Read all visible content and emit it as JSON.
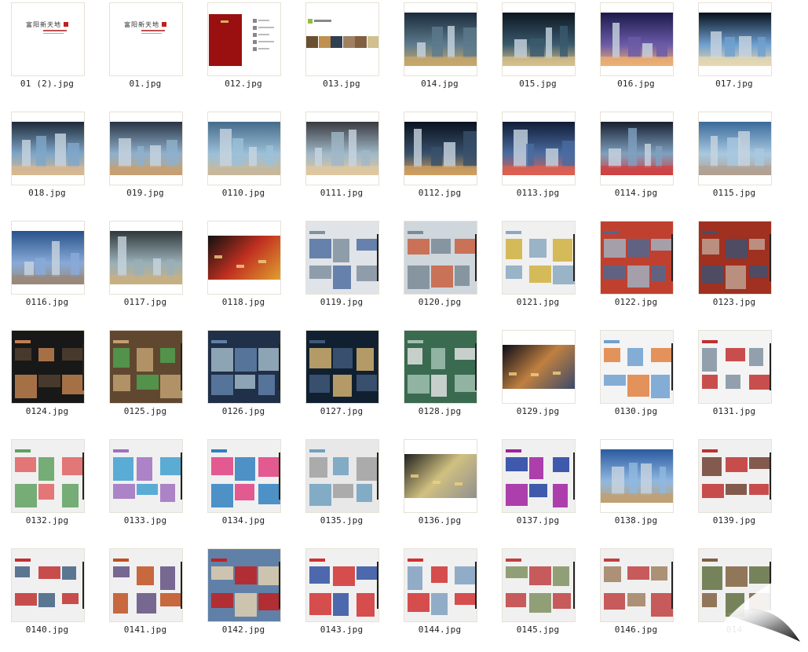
{
  "files": [
    {
      "name": "01 (2).jpg",
      "kind": "cover"
    },
    {
      "name": "01.jpg",
      "kind": "cover"
    },
    {
      "name": "012.jpg",
      "kind": "redbook"
    },
    {
      "name": "013.jpg",
      "kind": "strip"
    },
    {
      "name": "014.jpg",
      "kind": "render",
      "palette": [
        "#1a2b3c",
        "#5d7a8c",
        "#c9a86a"
      ]
    },
    {
      "name": "015.jpg",
      "kind": "render",
      "palette": [
        "#0d1620",
        "#3a5a6e",
        "#d9c08a"
      ]
    },
    {
      "name": "016.jpg",
      "kind": "render",
      "palette": [
        "#1b1a4a",
        "#6b5aa8",
        "#f0b070"
      ]
    },
    {
      "name": "017.jpg",
      "kind": "render",
      "palette": [
        "#06101c",
        "#6fa0d0",
        "#e8d8b0"
      ]
    },
    {
      "name": "018.jpg",
      "kind": "render",
      "palette": [
        "#1e2a3a",
        "#7fa6c8",
        "#d8b890"
      ]
    },
    {
      "name": "019.jpg",
      "kind": "render",
      "palette": [
        "#2a3545",
        "#8fb0cc",
        "#c8a070"
      ]
    },
    {
      "name": "0110.jpg",
      "kind": "render",
      "palette": [
        "#456b8a",
        "#9cc0d8",
        "#c8b89a"
      ]
    },
    {
      "name": "0111.jpg",
      "kind": "render",
      "palette": [
        "#3a3a40",
        "#a0b8c8",
        "#e0c8a0"
      ]
    },
    {
      "name": "0112.jpg",
      "kind": "render",
      "palette": [
        "#0a1220",
        "#38506a",
        "#d0a060"
      ]
    },
    {
      "name": "0113.jpg",
      "kind": "render",
      "palette": [
        "#101c38",
        "#4a6ca0",
        "#e06050"
      ]
    },
    {
      "name": "0114.jpg",
      "kind": "render",
      "palette": [
        "#182030",
        "#7fa0c0",
        "#d04040"
      ]
    },
    {
      "name": "0115.jpg",
      "kind": "render",
      "palette": [
        "#3a6a9a",
        "#a8c8e0",
        "#b0a090"
      ]
    },
    {
      "name": "0116.jpg",
      "kind": "render",
      "palette": [
        "#28528a",
        "#88aad8",
        "#9a8878"
      ]
    },
    {
      "name": "0117.jpg",
      "kind": "render",
      "palette": [
        "#30383a",
        "#9ab0b8",
        "#c8b080"
      ]
    },
    {
      "name": "0118.jpg",
      "kind": "photo-page",
      "palette": [
        "#101010",
        "#c03020",
        "#e0a030"
      ]
    },
    {
      "name": "0119.jpg",
      "kind": "layout",
      "palette": [
        "#e0e4e8",
        "#8090a0",
        "#5070a0"
      ]
    },
    {
      "name": "0120.jpg",
      "kind": "layout",
      "palette": [
        "#cfd6dc",
        "#7a8a96",
        "#c86040"
      ]
    },
    {
      "name": "0121.jpg",
      "kind": "layout",
      "palette": [
        "#f0f0f0",
        "#8aa8c0",
        "#d0b040"
      ]
    },
    {
      "name": "0122.jpg",
      "kind": "layout",
      "palette": [
        "#c04030",
        "#506890",
        "#a0b0c0"
      ]
    },
    {
      "name": "0123.jpg",
      "kind": "layout",
      "palette": [
        "#a03020",
        "#405070",
        "#c0a090"
      ]
    },
    {
      "name": "0124.jpg",
      "kind": "layout",
      "palette": [
        "#181818",
        "#c08050",
        "#504030"
      ]
    },
    {
      "name": "0125.jpg",
      "kind": "layout",
      "palette": [
        "#604830",
        "#c0a070",
        "#50a050"
      ]
    },
    {
      "name": "0126.jpg",
      "kind": "layout",
      "palette": [
        "#203048",
        "#6080a8",
        "#a0b8c8"
      ]
    },
    {
      "name": "0127.jpg",
      "kind": "layout",
      "palette": [
        "#102030",
        "#405878",
        "#d0b070"
      ]
    },
    {
      "name": "0128.jpg",
      "kind": "layout",
      "palette": [
        "#3a6a50",
        "#a0c0b0",
        "#e0e0e0"
      ]
    },
    {
      "name": "0129.jpg",
      "kind": "photo-page",
      "palette": [
        "#0a0c18",
        "#c08040",
        "#3a4a6a"
      ]
    },
    {
      "name": "0130.jpg",
      "kind": "layout",
      "palette": [
        "#f4f4f4",
        "#70a0d0",
        "#e08040"
      ]
    },
    {
      "name": "0131.jpg",
      "kind": "layout",
      "palette": [
        "#f4f4f4",
        "#c03030",
        "#8090a0"
      ]
    },
    {
      "name": "0132.jpg",
      "kind": "layout",
      "palette": [
        "#f0f0f0",
        "#60a060",
        "#e06060"
      ]
    },
    {
      "name": "0133.jpg",
      "kind": "layout",
      "palette": [
        "#f0f0f0",
        "#a070c0",
        "#40a0d0"
      ]
    },
    {
      "name": "0134.jpg",
      "kind": "layout",
      "palette": [
        "#f0f0f0",
        "#3080c0",
        "#e04080"
      ]
    },
    {
      "name": "0135.jpg",
      "kind": "layout",
      "palette": [
        "#e8e8e8",
        "#70a0c0",
        "#a0a0a0"
      ]
    },
    {
      "name": "0136.jpg",
      "kind": "photo-page",
      "palette": [
        "#202020",
        "#d0c080",
        "#909090"
      ]
    },
    {
      "name": "0137.jpg",
      "kind": "layout",
      "palette": [
        "#f0f0f0",
        "#a020a0",
        "#2040a0"
      ]
    },
    {
      "name": "0138.jpg",
      "kind": "render",
      "palette": [
        "#2a5aa0",
        "#90b8e0",
        "#c0a070"
      ]
    },
    {
      "name": "0139.jpg",
      "kind": "layout",
      "palette": [
        "#f0f0f0",
        "#c03030",
        "#704030"
      ]
    },
    {
      "name": "0140.jpg",
      "kind": "layout",
      "palette": [
        "#f0f0f0",
        "#c03030",
        "#406080"
      ]
    },
    {
      "name": "0141.jpg",
      "kind": "layout",
      "palette": [
        "#f0f0f0",
        "#c05020",
        "#605080"
      ]
    },
    {
      "name": "0142.jpg",
      "kind": "layout",
      "palette": [
        "#6080a8",
        "#c02020",
        "#e0d0b0"
      ]
    },
    {
      "name": "0143.jpg",
      "kind": "layout",
      "palette": [
        "#f0f0f0",
        "#d03030",
        "#3050a0"
      ]
    },
    {
      "name": "0144.jpg",
      "kind": "layout",
      "palette": [
        "#f0f0f0",
        "#d03030",
        "#80a0c0"
      ]
    },
    {
      "name": "0145.jpg",
      "kind": "layout",
      "palette": [
        "#f0f0f0",
        "#c04040",
        "#809060"
      ]
    },
    {
      "name": "0146.jpg",
      "kind": "layout",
      "palette": [
        "#f0f0f0",
        "#c04040",
        "#a08060"
      ]
    },
    {
      "name": "014",
      "kind": "layout",
      "palette": [
        "#f0f0f0",
        "#806040",
        "#607040"
      ]
    }
  ],
  "cover_text": "富阳新天地"
}
